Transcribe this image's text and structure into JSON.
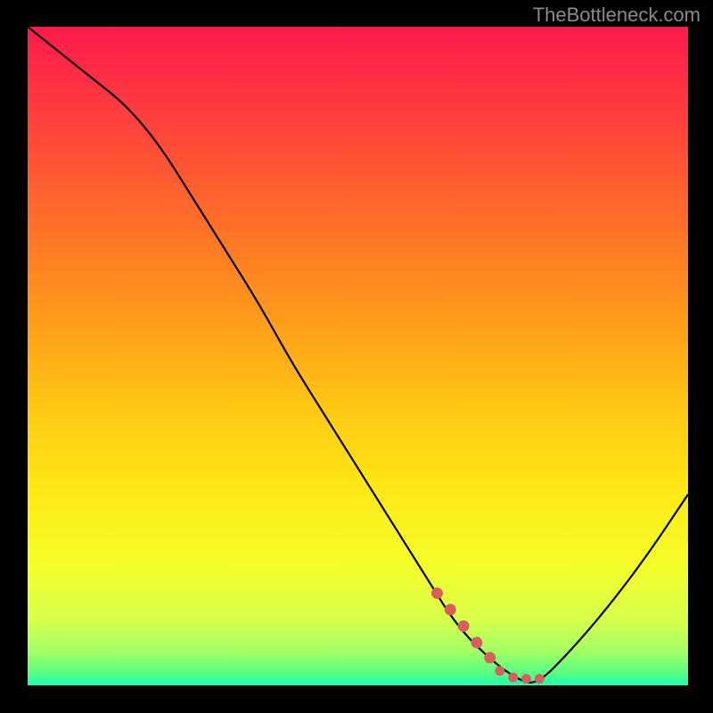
{
  "attribution": "TheBottleneck.com",
  "chart_data": {
    "type": "line",
    "title": "",
    "xlabel": "",
    "ylabel": "",
    "x_range_normalized": [
      0,
      1
    ],
    "y_range_normalized": [
      0,
      1
    ],
    "description": "Bottleneck V-curve over a vertical green-yellow-red gradient. Y value appears to represent bottleneck percentage (red=high, green=low). Curve drops from top-left to a minimum near x≈0.77 then rises again. A set of red highlight dots marks the descending approach to the minimum around x≈0.62–0.77.",
    "series": [
      {
        "name": "bottleneck-curve",
        "x": [
          0.0,
          0.05,
          0.1,
          0.15,
          0.2,
          0.25,
          0.3,
          0.35,
          0.4,
          0.45,
          0.5,
          0.55,
          0.6,
          0.65,
          0.7,
          0.74,
          0.77,
          0.82,
          0.88,
          0.94,
          1.0
        ],
        "y": [
          1.0,
          0.96,
          0.92,
          0.88,
          0.82,
          0.74,
          0.66,
          0.58,
          0.49,
          0.41,
          0.33,
          0.25,
          0.17,
          0.09,
          0.04,
          0.01,
          0.0,
          0.05,
          0.12,
          0.2,
          0.29
        ]
      }
    ],
    "highlight_points": {
      "name": "marked-region",
      "x": [
        0.62,
        0.64,
        0.66,
        0.68,
        0.7,
        0.715,
        0.735,
        0.755,
        0.775
      ],
      "y": [
        0.14,
        0.115,
        0.09,
        0.065,
        0.042,
        0.022,
        0.012,
        0.01,
        0.01
      ]
    },
    "gradient_stops": [
      {
        "offset": 0.0,
        "color": "#ff1a4d"
      },
      {
        "offset": 0.12,
        "color": "#ff3a3f"
      },
      {
        "offset": 0.28,
        "color": "#ff6a2a"
      },
      {
        "offset": 0.44,
        "color": "#ff9a1a"
      },
      {
        "offset": 0.58,
        "color": "#ffc814"
      },
      {
        "offset": 0.7,
        "color": "#ffe714"
      },
      {
        "offset": 0.82,
        "color": "#f4ff2a"
      },
      {
        "offset": 0.9,
        "color": "#d7ff4a"
      },
      {
        "offset": 0.95,
        "color": "#a2ff66"
      },
      {
        "offset": 0.985,
        "color": "#4dff88"
      },
      {
        "offset": 1.0,
        "color": "#1affb3"
      }
    ]
  }
}
